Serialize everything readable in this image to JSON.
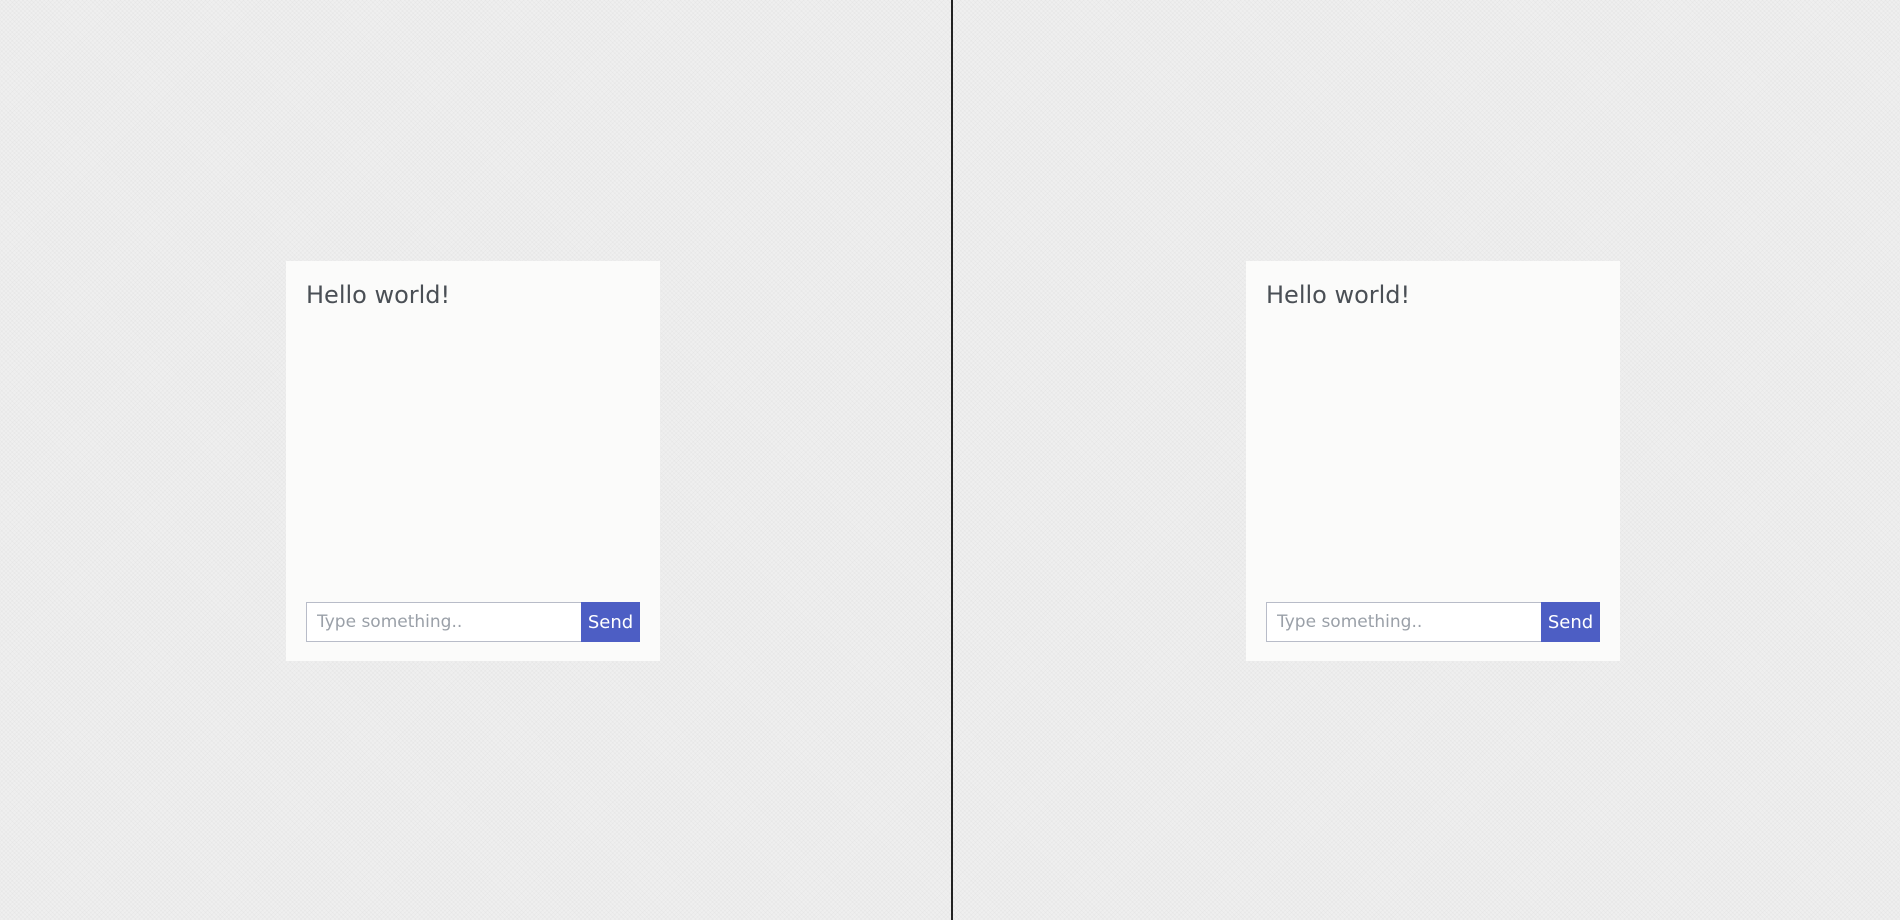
{
  "colors": {
    "background": "#efefef",
    "card": "#fbfbfa",
    "accent": "#4d5ec4",
    "text": "#4a4f55",
    "divider": "#222222"
  },
  "left_pane": {
    "message": "Hello world!",
    "input_placeholder": "Type something..",
    "input_value": "",
    "send_label": "Send"
  },
  "right_pane": {
    "message": "Hello world!",
    "input_placeholder": "Type something..",
    "input_value": "",
    "send_label": "Send"
  }
}
